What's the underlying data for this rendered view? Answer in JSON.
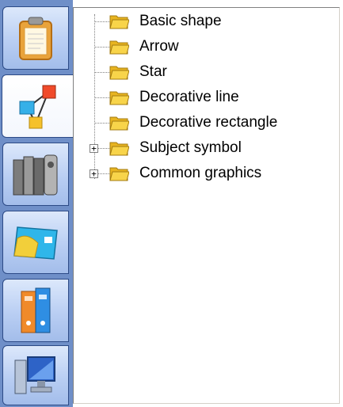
{
  "sidebar": {
    "tabs": [
      {
        "name": "clipboard",
        "icon": "clipboard-icon",
        "active": false
      },
      {
        "name": "shapes",
        "icon": "shapes-network-icon",
        "active": true
      },
      {
        "name": "library",
        "icon": "library-books-icon",
        "active": false
      },
      {
        "name": "card",
        "icon": "card-icon",
        "active": false
      },
      {
        "name": "binders",
        "icon": "binders-icon",
        "active": false
      },
      {
        "name": "computer",
        "icon": "computer-icon",
        "active": false
      }
    ]
  },
  "tree": {
    "items": [
      {
        "label": "Basic shape",
        "expandable": false
      },
      {
        "label": "Arrow",
        "expandable": false
      },
      {
        "label": "Star",
        "expandable": false
      },
      {
        "label": "Decorative line",
        "expandable": false
      },
      {
        "label": "Decorative rectangle",
        "expandable": false
      },
      {
        "label": "Subject symbol",
        "expandable": true,
        "expander": "+"
      },
      {
        "label": "Common graphics",
        "expandable": true,
        "expander": "+"
      }
    ]
  },
  "colors": {
    "tabbar": "#6f8fc8",
    "folder": "#f2c630"
  }
}
